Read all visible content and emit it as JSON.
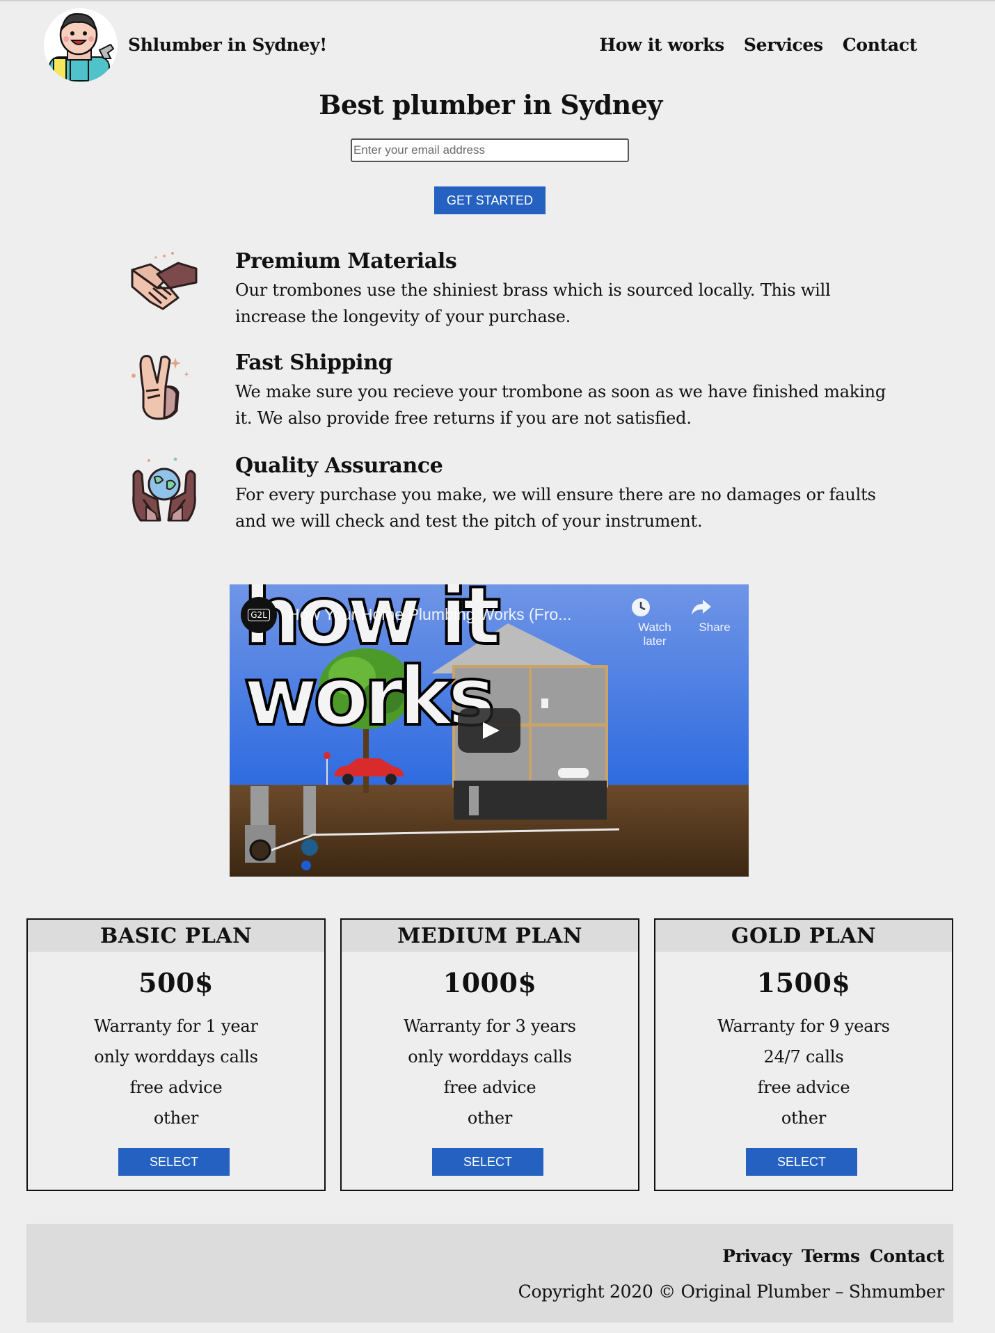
{
  "header": {
    "brand": "Shlumber in Sydney!",
    "nav": [
      {
        "label": "How it works"
      },
      {
        "label": "Services"
      },
      {
        "label": "Contact"
      }
    ]
  },
  "hero": {
    "title": "Best plumber in Sydney",
    "email_placeholder": "Enter your email address",
    "email_value": "",
    "cta_label": "GET STARTED"
  },
  "features": [
    {
      "icon": "handshake-icon",
      "title": "Premium Materials",
      "description": "Our trombones use the shiniest brass which is sourced locally. This will increase the longevity of your purchase."
    },
    {
      "icon": "peace-hand-icon",
      "title": "Fast Shipping",
      "description": "We make sure you recieve your trombone as soon as we have finished making it. We also provide free returns if you are not satisfied."
    },
    {
      "icon": "hands-globe-icon",
      "title": "Quality Assurance",
      "description": "For every purchase you make, we will ensure there are no damages or faults and we will check and test the pitch of your instrument."
    }
  ],
  "video": {
    "overlay_text": "how it works",
    "channel_badge": "G2L",
    "title": "How Your Home Plumbing Works (Fro...",
    "watch_later": "Watch later",
    "share": "Share"
  },
  "plans": [
    {
      "name": "BASIC PLAN",
      "price": "500$",
      "features": [
        "Warranty for 1 year",
        "only worddays calls",
        "free advice",
        "other"
      ],
      "button": "SELECT"
    },
    {
      "name": "MEDIUM PLAN",
      "price": "1000$",
      "features": [
        "Warranty for 3 years",
        "only worddays calls",
        "free advice",
        "other"
      ],
      "button": "SELECT"
    },
    {
      "name": "GOLD PLAN",
      "price": "1500$",
      "features": [
        "Warranty for 9 years",
        "24/7 calls",
        "free advice",
        "other"
      ],
      "button": "SELECT"
    }
  ],
  "footer": {
    "links": [
      {
        "label": "Privacy"
      },
      {
        "label": "Terms"
      },
      {
        "label": "Contact"
      }
    ],
    "copyright": "Copyright 2020 © Original Plumber – Shmumber"
  },
  "colors": {
    "page_bg": "#eeeeee",
    "button_blue": "#2461c1",
    "panel_gray": "#dcdcdc"
  }
}
